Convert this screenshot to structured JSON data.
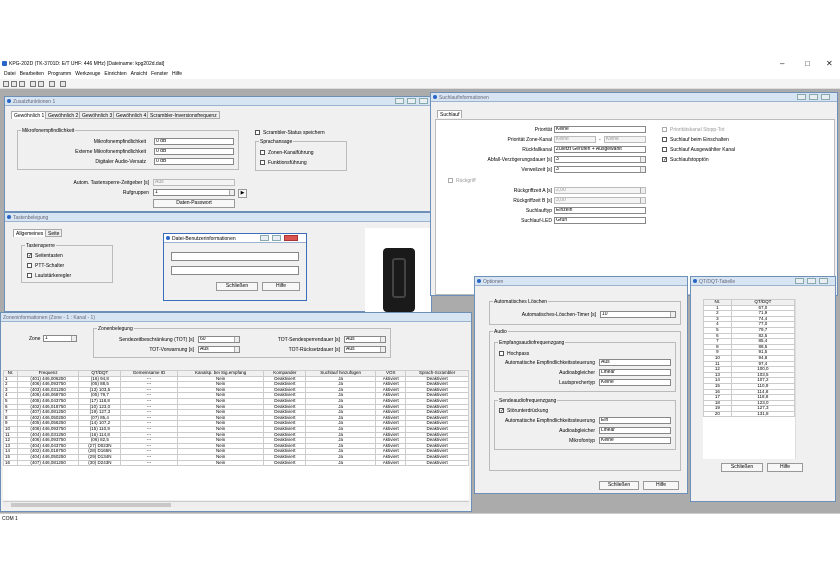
{
  "app": {
    "title": "KPG-202D (TK-3701D: E/T UHF: 446 MHz) [Dateiname: kpg202d.dat]",
    "status": "COM 1"
  },
  "menu": [
    "Datei",
    "Bearbeiten",
    "Programm",
    "Werkzeuge",
    "Einrichten",
    "Ansicht",
    "Fenster",
    "Hilfe"
  ],
  "zusatz": {
    "title": "Zusatzfunktionen 1",
    "tabs": [
      "Gewöhnlich 1",
      "Gewöhnlich 2",
      "Gewöhnlich 3",
      "Gewöhnlich 4",
      "Scrambler-Inversionsfrequenz"
    ],
    "mic_group": "Mikrofonempfindlichkeit",
    "mic": [
      {
        "label": "Mikrofonempfindlichkeit",
        "value": "0 dB"
      },
      {
        "label": "Externe Mikrofonempfindlichkeit",
        "value": "0 dB"
      },
      {
        "label": "Digitaler Audio-Versatz",
        "value": "0 dB"
      }
    ],
    "scrambler_status": "Scrambler-Status speichern",
    "speech_group": "Sprachansage",
    "zone_speech": "Zonen-Kanalführung",
    "func_speech": "Funktionsführung",
    "auto_key_label": "Autom. Tastensperre-Zeitgeber [s]",
    "auto_key_value": "Aus",
    "ruf_label": "Rufgruppen",
    "ruf_value": "1",
    "daten_pw": "Daten-Passwort"
  },
  "taste": {
    "title": "Tastenbelegung",
    "tabs": [
      "Allgemeines",
      "Seite"
    ],
    "group": "Tastensperre",
    "items": [
      {
        "label": "Seitentasten",
        "checked": "✓"
      },
      {
        "label": "PTT-Schalter",
        "checked": ""
      },
      {
        "label": "Lautstärkeregler",
        "checked": ""
      }
    ]
  },
  "dbi": {
    "title": "Datei-Benutzerinformationen",
    "line1": "",
    "line2": "",
    "close": "Schließen",
    "help": "Hilfe"
  },
  "zone": {
    "title": "Zoneninformationen (Zone - 1 : Kanal - 1)",
    "zone_label": "Zone",
    "zone_value": "1",
    "group": "Zonenbelegung",
    "tot_label": "Sendezeitbeschränkung (TOT) [s]",
    "tot_value": "60",
    "totpre_label": "TOT-Vorwarnung [s]",
    "totpre_value": "Aus",
    "totrekey_label": "TOT-Sendesperrendauer [s]",
    "totrekey_value": "Aus",
    "totreset_label": "TOT-Rücksetzdauer [s]",
    "totreset_value": "Aus",
    "headers": [
      "Nr.",
      "Frequenz",
      "QT/DQT",
      "Gemeinsame ID",
      "Kanalsp. bei Sig.empfang",
      "Kompander",
      "Suchlauf hinzufügen",
      "VOX",
      "Sprach-Scrambler"
    ],
    "rows": [
      [
        "1",
        "(401) 446,006250",
        "(16) 94,8",
        "---",
        "Nein",
        "Deaktiviert",
        "Ja",
        "Aktiviert",
        "Deaktiviert"
      ],
      [
        "2",
        "(406) 446,093750",
        "(05) 88,5",
        "---",
        "Nein",
        "Deaktiviert",
        "Ja",
        "Aktiviert",
        "Deaktiviert"
      ],
      [
        "3",
        "(403) 446,031250",
        "(13) 103,5",
        "---",
        "Nein",
        "Deaktiviert",
        "Ja",
        "Aktiviert",
        "Deaktiviert"
      ],
      [
        "4",
        "(406) 446,068750",
        "(05) 79,7",
        "---",
        "Nein",
        "Deaktiviert",
        "Ja",
        "Aktiviert",
        "Deaktiviert"
      ],
      [
        "5",
        "(405) 446,043750",
        "(17) 118,8",
        "---",
        "Nein",
        "Deaktiviert",
        "Ja",
        "Aktiviert",
        "Deaktiviert"
      ],
      [
        "6",
        "(402) 446,018750",
        "(10) 123,0",
        "---",
        "Nein",
        "Deaktiviert",
        "Ja",
        "Aktiviert",
        "Deaktiviert"
      ],
      [
        "7",
        "(407) 446,081250",
        "(19) 127,3",
        "---",
        "Nein",
        "Deaktiviert",
        "Ja",
        "Aktiviert",
        "Deaktiviert"
      ],
      [
        "8",
        "(402) 446,050250",
        "(07) 85,4",
        "---",
        "Nein",
        "Deaktiviert",
        "Ja",
        "Aktiviert",
        "Deaktiviert"
      ],
      [
        "9",
        "(405) 446,056250",
        "(14) 107,2",
        "---",
        "Nein",
        "Deaktiviert",
        "Ja",
        "Aktiviert",
        "Deaktiviert"
      ],
      [
        "10",
        "(406) 446,093750",
        "(15) 110,9",
        "---",
        "Nein",
        "Deaktiviert",
        "Ja",
        "Aktiviert",
        "Deaktiviert"
      ],
      [
        "11",
        "(404) 446,031250",
        "(16) 114,8",
        "---",
        "Nein",
        "Deaktiviert",
        "Ja",
        "Aktiviert",
        "Deaktiviert"
      ],
      [
        "12",
        "(406) 446,093750",
        "(06) 82,5",
        "---",
        "Nein",
        "Deaktiviert",
        "Ja",
        "Aktiviert",
        "Deaktiviert"
      ],
      [
        "13",
        "(404) 446,043750",
        "(27) D023N",
        "---",
        "Nein",
        "Deaktiviert",
        "Ja",
        "Aktiviert",
        "Deaktiviert"
      ],
      [
        "14",
        "(402) 446,018750",
        "(28) D165N",
        "---",
        "Nein",
        "Deaktiviert",
        "Ja",
        "Aktiviert",
        "Deaktiviert"
      ],
      [
        "15",
        "(404) 446,050250",
        "(29) D134N",
        "---",
        "Nein",
        "Deaktiviert",
        "Ja",
        "Aktiviert",
        "Deaktiviert"
      ],
      [
        "16",
        "(407) 446,081250",
        "(30) D243N",
        "---",
        "Nein",
        "Deaktiviert",
        "Ja",
        "Aktiviert",
        "Deaktiviert"
      ]
    ]
  },
  "such": {
    "title": "Suchlaufinformationen",
    "tab": "Suchlauf",
    "prio_label": "Priorität",
    "prio_value": "Keine",
    "prio_zone_label": "Priorität Zone-Kanal",
    "prio_zone_a": "Keine",
    "prio_zone_b": "Keine",
    "rueck_label": "Rückfallkanal",
    "rueck_value": "Zuletzt Gerufen + Ausgewählt",
    "dropout_label": "Abfall-Verzögerungsdauer [s]",
    "dropout_value": "3",
    "dwell_label": "Verweilzeit [s]",
    "dwell_value": "3",
    "prio_ch_stop": "Prioritätskanal Stopp-Tot",
    "scan_power": "Suchlauf beim Einschalten",
    "scan_sel": "Suchlauf Ausgewählter Kanal",
    "scan_stop": "Suchlaufstopptön",
    "revert_chk": "Rückgriff",
    "revert_a_label": "Rückgriffzeit A [s]",
    "revert_a_value": "2,00",
    "revert_b_label": "Rückgriffzeit B [s]",
    "revert_b_value": "3,00",
    "type_label": "Suchlauftyp",
    "type_value": "Einzeln",
    "led_label": "Suchlauf-LED",
    "led_value": "Grün"
  },
  "opt": {
    "title": "Optionen",
    "auto_group": "Automatisches Löschen",
    "auto_label": "Automatisches-Löschen-Timer [s]",
    "auto_value": "10",
    "audio_group": "Audio",
    "rx_group": "Empfangsaudiofrequenzgang",
    "hochpass": "Hochpass",
    "rx_sens_label": "Automatische Empfindlichkeitssteuerung",
    "rx_sens_value": "Aus",
    "eq_label": "Audioabgleicher",
    "eq_value": "Linear",
    "spk_label": "Lautsprechertyp",
    "spk_value": "Keine",
    "tx_group": "Sendeaudiofrequenzgang",
    "noise": "Störunterdrückung",
    "tx_sens_label": "Automatische Empfindlichkeitssteuerung",
    "tx_sens_value": "Ein",
    "tx_eq_label": "Audioabgleicher",
    "tx_eq_value": "Linear",
    "mic_label": "Mikrofontyp",
    "mic_value": "Keine",
    "close": "Schließen",
    "help": "Hilfe"
  },
  "qt": {
    "title": "QT/DQT-Tabelle",
    "headers": [
      "Nr.",
      "QT/DQT"
    ],
    "rows": [
      [
        "1",
        "67,0"
      ],
      [
        "2",
        "71,9"
      ],
      [
        "3",
        "74,4"
      ],
      [
        "4",
        "77,0"
      ],
      [
        "5",
        "79,7"
      ],
      [
        "6",
        "82,5"
      ],
      [
        "7",
        "85,4"
      ],
      [
        "8",
        "88,5"
      ],
      [
        "9",
        "91,5"
      ],
      [
        "10",
        "94,8"
      ],
      [
        "11",
        "97,4"
      ],
      [
        "12",
        "100,0"
      ],
      [
        "13",
        "103,5"
      ],
      [
        "14",
        "107,2"
      ],
      [
        "15",
        "110,9"
      ],
      [
        "16",
        "114,8"
      ],
      [
        "17",
        "118,8"
      ],
      [
        "18",
        "123,0"
      ],
      [
        "19",
        "127,3"
      ],
      [
        "20",
        "131,8"
      ]
    ],
    "close": "Schließen",
    "help": "Hilfe"
  }
}
